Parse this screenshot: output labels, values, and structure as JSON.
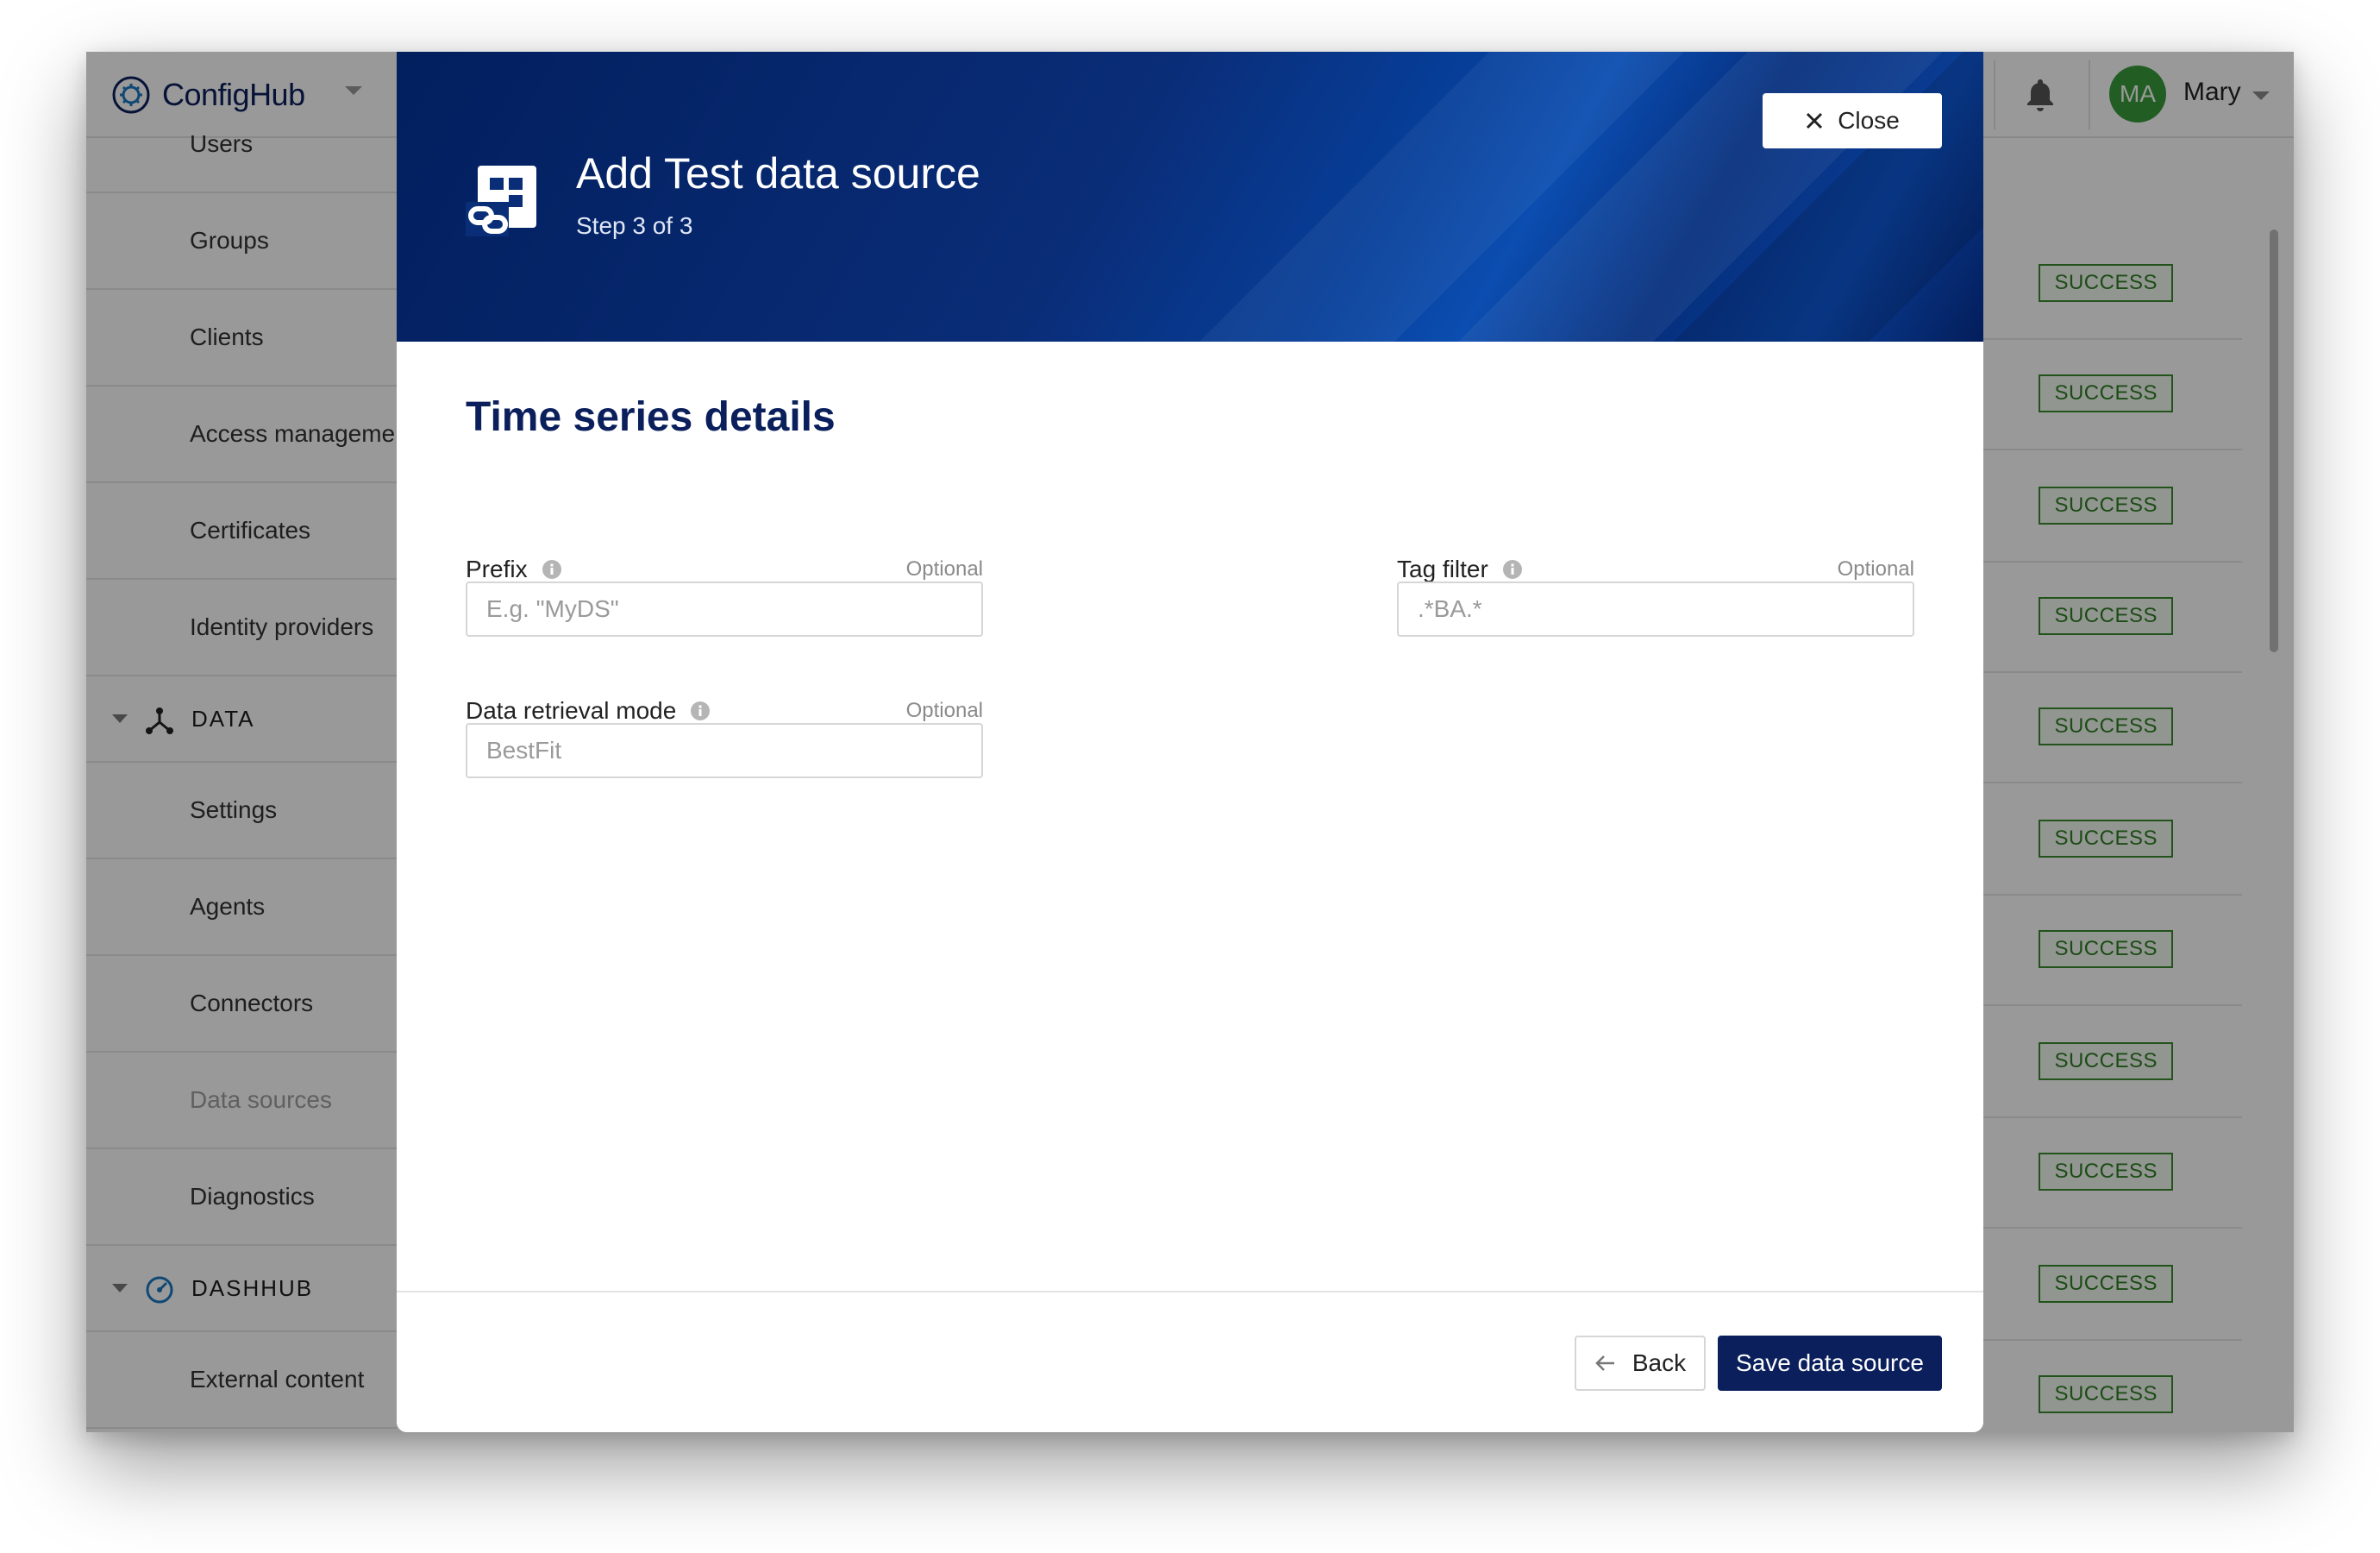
{
  "app": {
    "brand_name": "ConfigHub",
    "user_initials": "MA",
    "user_name": "Mary",
    "avatar_color": "#3a9d3c"
  },
  "sidebar": {
    "items_top": [
      {
        "label": "Users"
      },
      {
        "label": "Groups"
      },
      {
        "label": "Clients"
      },
      {
        "label": "Access management"
      },
      {
        "label": "Certificates"
      },
      {
        "label": "Identity providers"
      }
    ],
    "data_section": {
      "label": "DATA",
      "icon": "data-hub-icon"
    },
    "items_data": [
      {
        "label": "Settings"
      },
      {
        "label": "Agents"
      },
      {
        "label": "Connectors"
      },
      {
        "label": "Data sources",
        "active": true
      },
      {
        "label": "Diagnostics"
      }
    ],
    "dashhub_section": {
      "label": "DASHHUB",
      "icon": "gauge-icon"
    },
    "items_dashhub": [
      {
        "label": "External content"
      }
    ]
  },
  "main": {
    "status_badges": [
      "SUCCESS",
      "SUCCESS",
      "SUCCESS",
      "SUCCESS",
      "SUCCESS",
      "SUCCESS",
      "SUCCESS",
      "SUCCESS",
      "SUCCESS",
      "SUCCESS",
      "SUCCESS"
    ]
  },
  "modal": {
    "title": "Add Test data source",
    "step": "Step 3 of 3",
    "close_label": "Close",
    "section_title": "Time series details",
    "fields": {
      "prefix": {
        "label": "Prefix",
        "optional": "Optional",
        "placeholder": "E.g. \"MyDS\"",
        "value": ""
      },
      "tag_filter": {
        "label": "Tag filter",
        "optional": "Optional",
        "placeholder": ".*BA.*",
        "value": ""
      },
      "retrieval_mode": {
        "label": "Data retrieval mode",
        "optional": "Optional",
        "placeholder": "BestFit",
        "value": ""
      }
    },
    "back_label": "Back",
    "save_label": "Save data source"
  },
  "colors": {
    "brand_navy": "#0a1f5c",
    "success_green": "#2f7f25"
  }
}
